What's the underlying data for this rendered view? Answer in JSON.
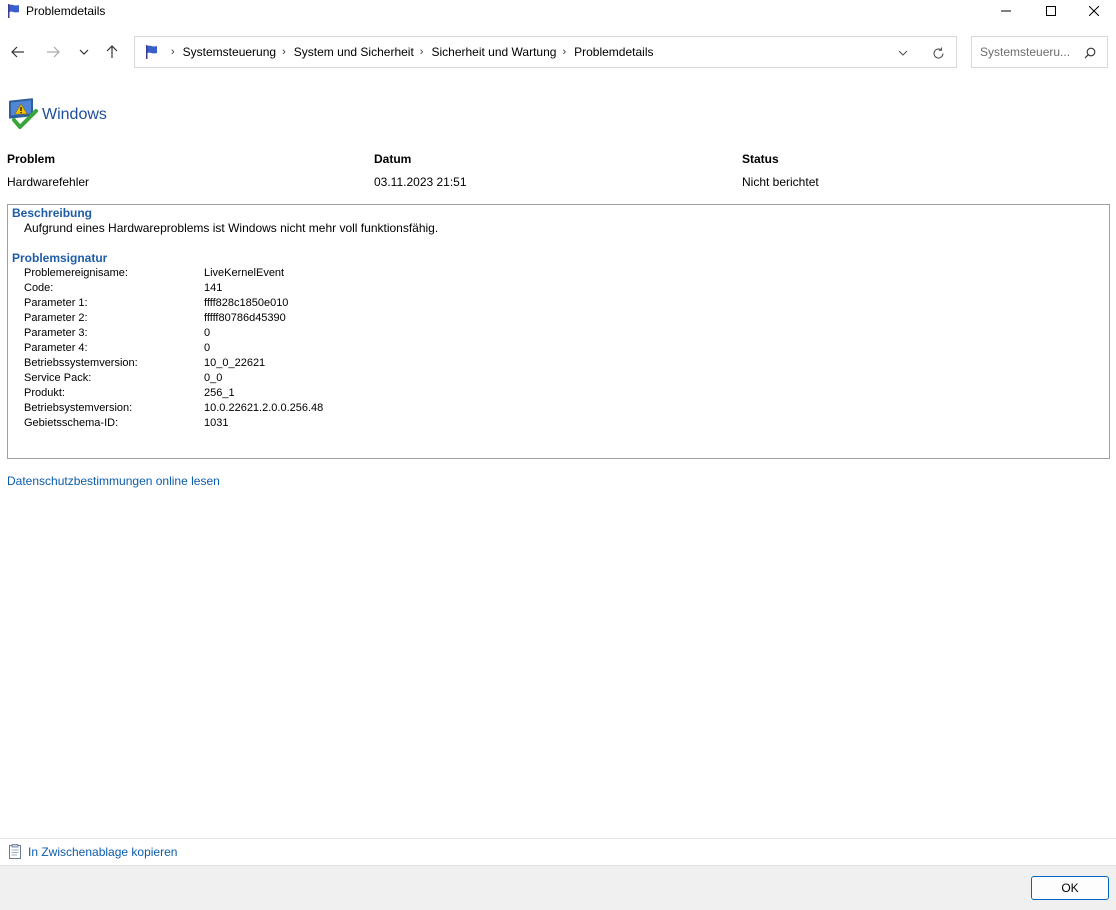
{
  "window": {
    "title": "Problemdetails"
  },
  "address": {
    "crumbs": [
      "Systemsteuerung",
      "System und Sicherheit",
      "Sicherheit und Wartung",
      "Problemdetails"
    ]
  },
  "search": {
    "placeholder": "Systemsteueru..."
  },
  "header": {
    "title": "Windows"
  },
  "summary": {
    "problem_label": "Problem",
    "date_label": "Datum",
    "status_label": "Status",
    "problem_value": "Hardwarefehler",
    "date_value": "03.11.2023 21:51",
    "status_value": "Nicht berichtet"
  },
  "details": {
    "description_title": "Beschreibung",
    "description_text": "Aufgrund eines Hardwareproblems ist Windows nicht mehr voll funktionsfähig.",
    "signature_title": "Problemsignatur",
    "signature": [
      {
        "key": "Problemereignisame:",
        "value": "LiveKernelEvent"
      },
      {
        "key": "Code:",
        "value": "141"
      },
      {
        "key": "Parameter 1:",
        "value": "ffff828c1850e010"
      },
      {
        "key": "Parameter 2:",
        "value": "fffff80786d45390"
      },
      {
        "key": "Parameter 3:",
        "value": "0"
      },
      {
        "key": "Parameter 4:",
        "value": "0"
      },
      {
        "key": "Betriebssystemversion:",
        "value": "10_0_22621"
      },
      {
        "key": "Service Pack:",
        "value": "0_0"
      },
      {
        "key": "Produkt:",
        "value": "256_1"
      },
      {
        "key": "Betriebsystemversion:",
        "value": "10.0.22621.2.0.0.256.48"
      },
      {
        "key": "Gebietsschema-ID:",
        "value": "1031"
      }
    ]
  },
  "links": {
    "privacy": "Datenschutzbestimmungen online lesen",
    "copy": "In Zwischenablage kopieren"
  },
  "footer": {
    "ok_label": "OK"
  },
  "icons": {
    "title_icon": "flag-icon",
    "app_icon": "windows-problem-report-icon",
    "copy_icon": "clipboard-icon"
  },
  "colors": {
    "accent": "#1e5ca8",
    "link": "#0b5cad",
    "heading": "#1e4e9a"
  }
}
